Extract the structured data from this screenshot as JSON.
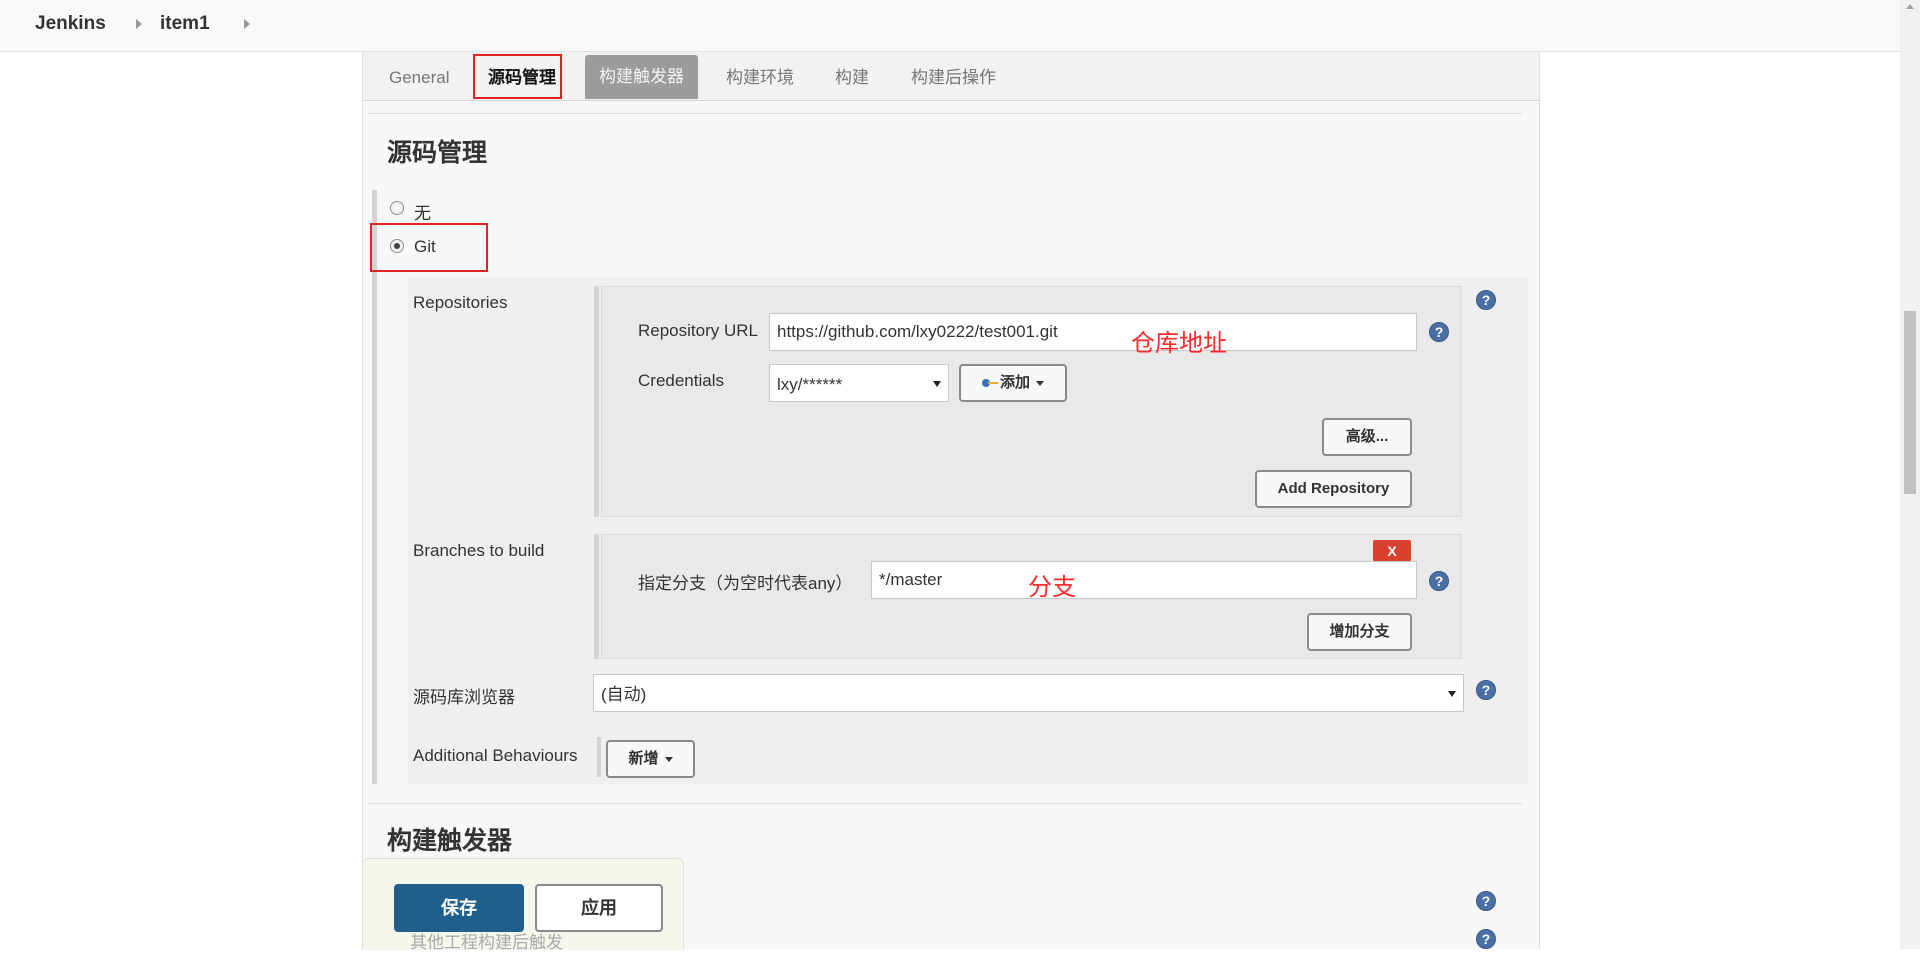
{
  "breadcrumb": {
    "home": "Jenkins",
    "item": "item1"
  },
  "tabs": [
    {
      "label": "General"
    },
    {
      "label": "源码管理"
    },
    {
      "label": "构建触发器"
    },
    {
      "label": "构建环境"
    },
    {
      "label": "构建"
    },
    {
      "label": "构建后操作"
    }
  ],
  "scm": {
    "title": "源码管理",
    "options": {
      "none": "无",
      "git": "Git"
    },
    "repositories_label": "Repositories",
    "repo_url_label": "Repository URL",
    "repo_url_value": "https://github.com/lxy0222/test001.git",
    "repo_url_note": "仓库地址",
    "credentials_label": "Credentials",
    "credentials_value": "lxy/******",
    "add_label": "添加",
    "advanced_label": "高级...",
    "add_repository_label": "Add Repository",
    "branches_label": "Branches to build",
    "branch_specifier_label": "指定分支（为空时代表any）",
    "branch_value": "*/master",
    "branch_note": "分支",
    "delete_label": "X",
    "add_branch_label": "增加分支",
    "browser_label": "源码库浏览器",
    "browser_value": "(自动)",
    "behaviours_label": "Additional Behaviours",
    "new_label": "新增"
  },
  "triggers": {
    "title": "构建触发器",
    "hidden_text": "其他工程构建后触发"
  },
  "footer": {
    "save_label": "保存",
    "apply_label": "应用"
  }
}
